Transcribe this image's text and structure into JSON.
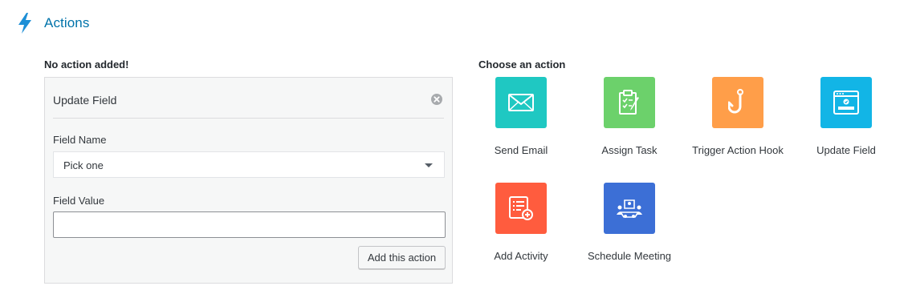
{
  "header": {
    "title": "Actions",
    "icon": "bolt-icon",
    "accent": "#0073aa"
  },
  "left": {
    "status": "No action added!",
    "panel": {
      "title": "Update Field",
      "field_name_label": "Field Name",
      "field_name_value": "Pick one",
      "field_value_label": "Field Value",
      "field_value_value": "",
      "add_button": "Add this action"
    }
  },
  "right": {
    "heading": "Choose an action",
    "actions": [
      {
        "label": "Send Email",
        "icon": "envelope-icon",
        "color": "#1fc8c2"
      },
      {
        "label": "Assign Task",
        "icon": "clipboard-icon",
        "color": "#6cd16b"
      },
      {
        "label": "Trigger Action Hook",
        "icon": "hook-icon",
        "color": "#ff9e49"
      },
      {
        "label": "Update Field",
        "icon": "form-window-icon",
        "color": "#12b5e6"
      },
      {
        "label": "Add Activity",
        "icon": "activity-add-icon",
        "color": "#ff5c3e"
      },
      {
        "label": "Schedule Meeting",
        "icon": "meeting-icon",
        "color": "#3c6fd6"
      }
    ]
  }
}
